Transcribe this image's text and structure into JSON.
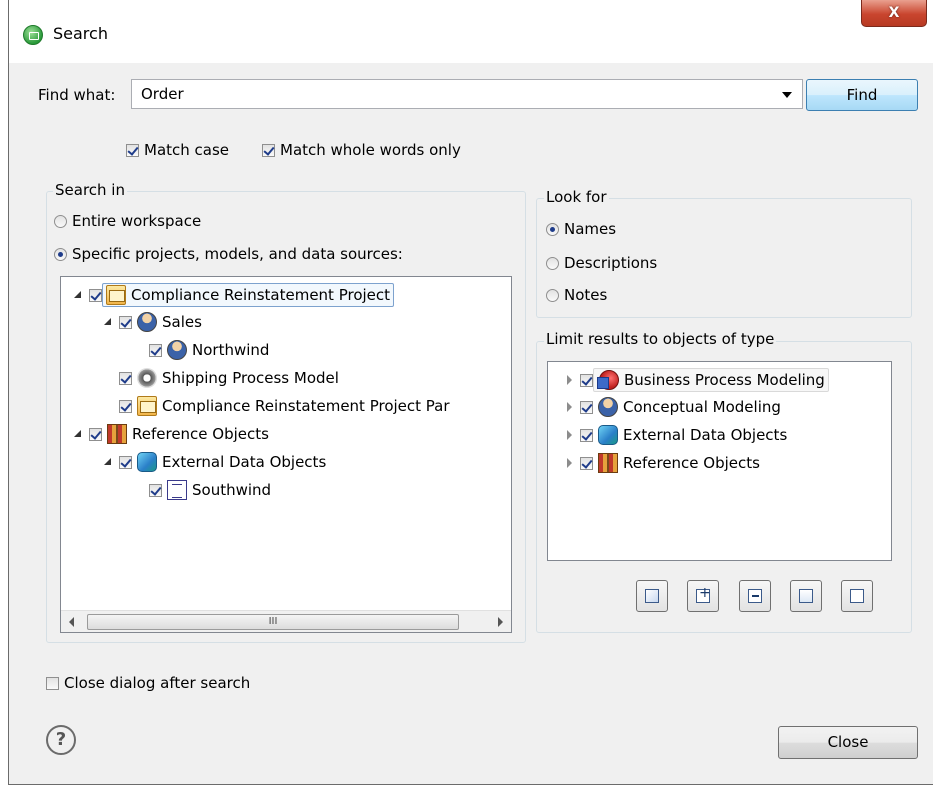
{
  "window": {
    "title": "Search",
    "close_label": "X"
  },
  "find": {
    "label": "Find what:",
    "value": "Order",
    "button": "Find"
  },
  "options": {
    "match_case": "Match case",
    "match_whole_words": "Match whole words only"
  },
  "search_in": {
    "title": "Search in",
    "entire_workspace": "Entire workspace",
    "specific": "Specific projects, models, and data sources:",
    "tree": [
      {
        "label": "Compliance Reinstatement Project"
      },
      {
        "label": "Sales"
      },
      {
        "label": "Northwind"
      },
      {
        "label": "Shipping Process Model"
      },
      {
        "label": "Compliance Reinstatement Project Par"
      },
      {
        "label": "Reference Objects"
      },
      {
        "label": "External Data Objects"
      },
      {
        "label": "Southwind"
      }
    ],
    "scroll_grip": "III"
  },
  "look_for": {
    "title": "Look for",
    "names": "Names",
    "descriptions": "Descriptions",
    "notes": "Notes"
  },
  "limit": {
    "title": "Limit results to objects of type",
    "items": [
      {
        "label": "Business Process Modeling"
      },
      {
        "label": "Conceptual Modeling"
      },
      {
        "label": "External Data Objects"
      },
      {
        "label": "Reference Objects"
      }
    ]
  },
  "close_after_search": "Close dialog after search",
  "help_symbol": "?",
  "close_button": "Close"
}
